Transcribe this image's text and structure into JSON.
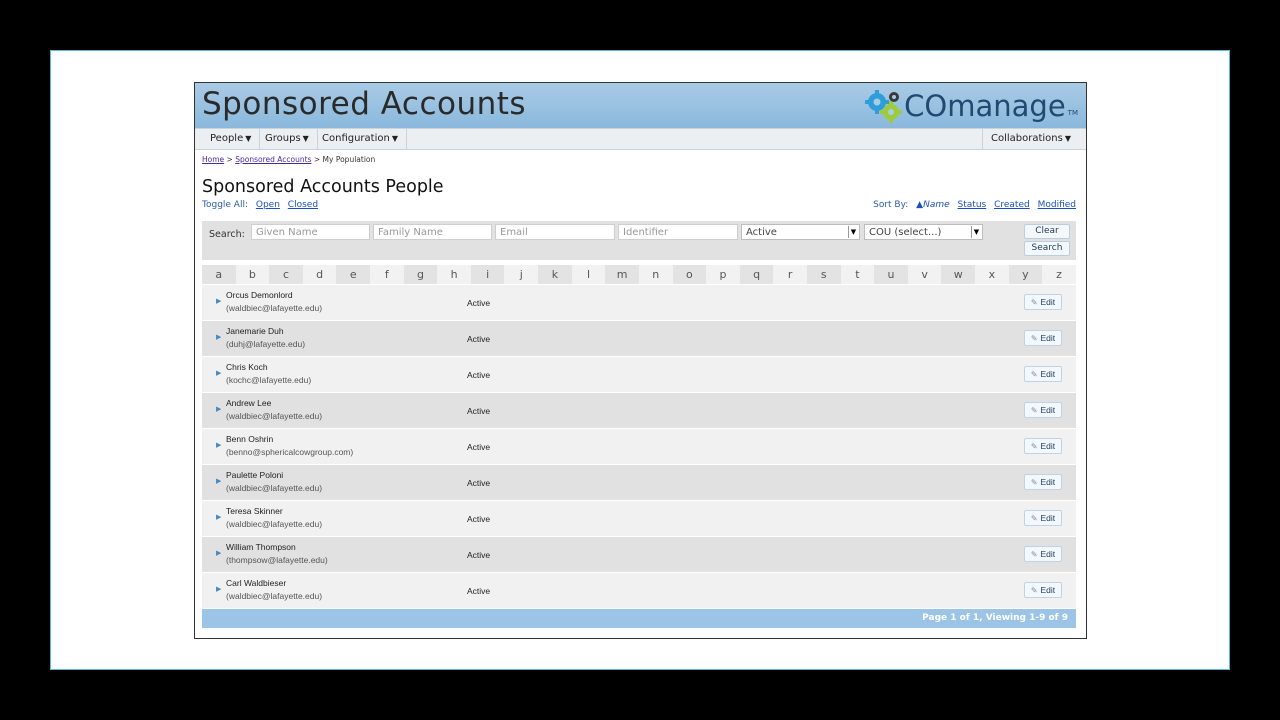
{
  "banner": {
    "title": "Sponsored Accounts",
    "logo_text": "COmanage",
    "logo_tm": "TM"
  },
  "nav": {
    "items": [
      {
        "label": "People"
      },
      {
        "label": "Groups"
      },
      {
        "label": "Configuration"
      }
    ],
    "right_item": {
      "label": "Collaborations"
    }
  },
  "breadcrumb": {
    "home": "Home",
    "sep1": ">",
    "sponsored": "Sponsored Accounts",
    "sep2": ">",
    "current": "My Population"
  },
  "page_title": "Sponsored Accounts People",
  "toggle": {
    "label": "Toggle All:",
    "open": "Open",
    "closed": "Closed"
  },
  "sort": {
    "label": "Sort By:",
    "active_arrow": "▲",
    "active": "Name",
    "status": "Status",
    "created": "Created",
    "modified": "Modified"
  },
  "search": {
    "label": "Search:",
    "given_name_placeholder": "Given Name",
    "family_name_placeholder": "Family Name",
    "email_placeholder": "Email",
    "identifier_placeholder": "Identifier",
    "status_value": "Active",
    "cou_value": "COU (select...)",
    "clear_label": "Clear",
    "search_label": "Search"
  },
  "alphabet": [
    "a",
    "b",
    "c",
    "d",
    "e",
    "f",
    "g",
    "h",
    "i",
    "j",
    "k",
    "l",
    "m",
    "n",
    "o",
    "p",
    "q",
    "r",
    "s",
    "t",
    "u",
    "v",
    "w",
    "x",
    "y",
    "z"
  ],
  "people": [
    {
      "name": "Orcus Demonlord",
      "email": "(waldbiec@lafayette.edu)",
      "status": "Active",
      "edit": "Edit"
    },
    {
      "name": "Janemarie Duh",
      "email": "(duhj@lafayette.edu)",
      "status": "Active",
      "edit": "Edit"
    },
    {
      "name": "Chris Koch",
      "email": "(kochc@lafayette.edu)",
      "status": "Active",
      "edit": "Edit"
    },
    {
      "name": "Andrew Lee",
      "email": "(waldbiec@lafayette.edu)",
      "status": "Active",
      "edit": "Edit"
    },
    {
      "name": "Benn Oshrin",
      "email": "(benno@sphericalcowgroup.com)",
      "status": "Active",
      "edit": "Edit"
    },
    {
      "name": "Paulette Poloni",
      "email": "(waldbiec@lafayette.edu)",
      "status": "Active",
      "edit": "Edit"
    },
    {
      "name": "Teresa Skinner",
      "email": "(waldbiec@lafayette.edu)",
      "status": "Active",
      "edit": "Edit"
    },
    {
      "name": "William Thompson",
      "email": "(thompsow@lafayette.edu)",
      "status": "Active",
      "edit": "Edit"
    },
    {
      "name": "Carl Waldbieser",
      "email": "(waldbiec@lafayette.edu)",
      "status": "Active",
      "edit": "Edit"
    }
  ],
  "pagination": "Page 1 of 1, Viewing 1-9 of 9",
  "colors": {
    "banner": "#8ab8dc",
    "link": "#1a50c0",
    "footer": "#9cc4e6"
  },
  "icons": {
    "logo": "gears-icon",
    "expand": "triangle-right-icon",
    "edit": "pencil-icon",
    "dropdown": "caret-down-icon"
  }
}
